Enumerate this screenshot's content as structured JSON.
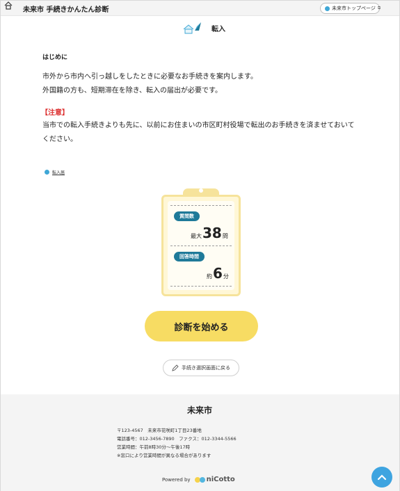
{
  "header": {
    "title": "未来市 手続きかんたん診断",
    "top_link": "未来市トップページ"
  },
  "page": {
    "heading": "転入"
  },
  "intro": {
    "title": "はじめに",
    "line1": "市外から市内へ引っ越しをしたときに必要なお手続きを案内します。",
    "line2": "外国籍の方も、短期滞在を除き、転入の届出が必要です。"
  },
  "note": {
    "title": "【注意】",
    "line1": "当市での転入手続きよりも先に、以前にお住まいの市区町村役場で転出のお手続きを済ませておいて",
    "line2": "ください。"
  },
  "tag": {
    "label": "転入届"
  },
  "summary": {
    "questions_label": "質問数",
    "questions_prefix": "最大",
    "questions_value": "38",
    "questions_unit": "問",
    "time_label": "回答時間",
    "time_prefix": "約",
    "time_value": "6",
    "time_unit": "分"
  },
  "actions": {
    "start": "診断を始める",
    "back": "手続き選択画面に戻る"
  },
  "footer": {
    "title": "未来市",
    "address": "〒123-4567　未来市花咲町1丁目23番地",
    "phone": "電話番号：012-3456-7890　ファクス：012-3344-5566",
    "hours": "営業時間：午前8時30分～午後17時",
    "note": "※窓口により営業時間が異なる場合があります",
    "powered_by": "Powered by",
    "logo_text": "niCotto"
  },
  "colors": {
    "accent_yellow": "#f7dc63",
    "pill_teal": "#1f7a99",
    "note_red": "#dd3333",
    "top_button_blue": "#3ea4e0"
  },
  "icons": [
    "home-icon",
    "house-heading-icon",
    "info-dot-icon",
    "external-link-icon",
    "pencil-icon",
    "chevron-up-icon"
  ]
}
